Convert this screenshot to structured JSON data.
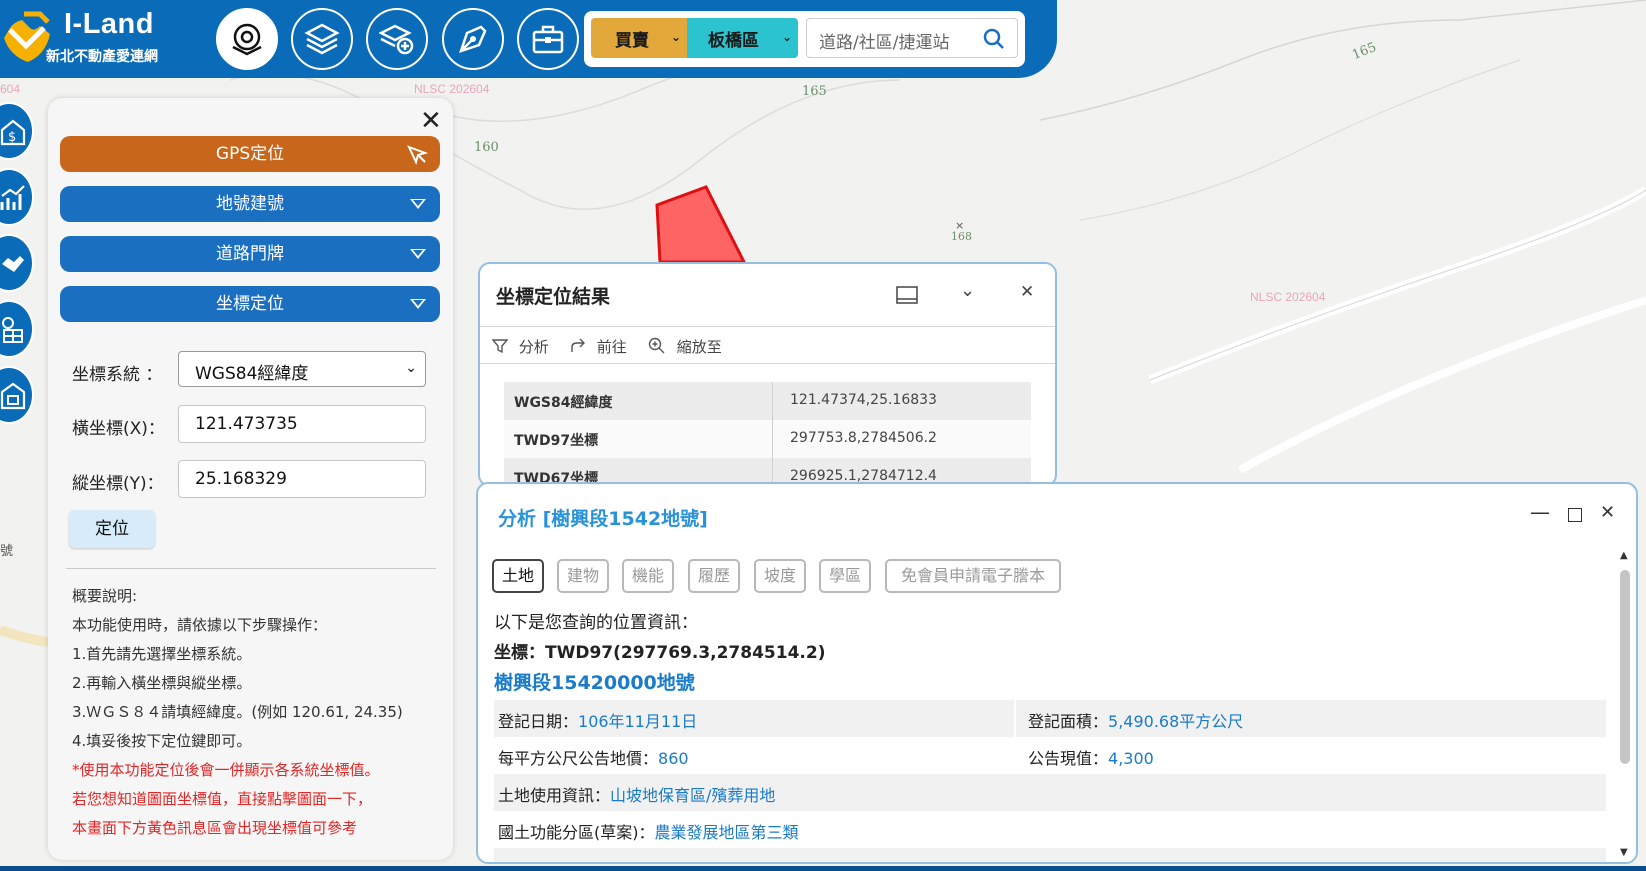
{
  "app": {
    "title": "I-Land",
    "subtitle": "新北不動產愛連網",
    "colors": {
      "brand_blue": "#0a6bb8",
      "mode_gold": "#e2a93a",
      "district_cyan": "#2bc3cf",
      "gps_orange": "#c8671b",
      "link_blue": "#1a7bc8"
    }
  },
  "toolbar": {
    "icons": [
      "target-layers-icon",
      "layers-icon",
      "add-layer-icon",
      "pen-icon",
      "toolbox-icon"
    ],
    "mode_select": "買賣",
    "district_select": "板橋區",
    "search_placeholder": "道路/社區/捷運站"
  },
  "map": {
    "contour_labels": [
      "160",
      "165",
      "165",
      "168"
    ],
    "watermarks": [
      "NLSC 202604",
      "NLSC 202604"
    ],
    "partial_labels": [
      "604",
      "號"
    ]
  },
  "locate_panel": {
    "gps_label": "GPS定位",
    "sections": [
      "地號建號",
      "道路門牌",
      "坐標定位"
    ],
    "coord_system_label": "坐標系統 ：",
    "coord_system_value": "WGS84經緯度",
    "x_label": "橫坐標(X)：",
    "x_value": "121.473735",
    "y_label": "縱坐標(Y)：",
    "y_value": "25.168329",
    "locate_button": "定位",
    "help_title": "概要說明:",
    "help_lines": [
      "本功能使用時，請依據以下步驟操作：",
      "1.首先請先選擇坐標系統。",
      "2.再輸入橫坐標與縱坐標。",
      "3.ＷＧＳ８４請填經緯度。(例如 120.61, 24.35)",
      "4.填妥後按下定位鍵即可。"
    ],
    "help_red_lines": [
      "*使用本功能定位後會一併顯示各系統坐標值。",
      "若您想知道圖面坐標值，直接點擊圖面一下，",
      "本畫面下方黃色訊息區會出現坐標值可參考"
    ]
  },
  "coord_window": {
    "title": "坐標定位結果",
    "tools": [
      "分析",
      "前往",
      "縮放至"
    ],
    "rows": [
      {
        "key": "WGS84經緯度",
        "value": "121.47374,25.16833"
      },
      {
        "key": "TWD97坐標",
        "value": "297753.8,2784506.2"
      },
      {
        "key": "TWD67坐標",
        "value": "296925.1,2784712.4"
      }
    ]
  },
  "analysis_window": {
    "title": "分析 [樹興段1542地號]",
    "tabs": [
      "土地",
      "建物",
      "機能",
      "履歷",
      "坡度",
      "學區",
      "免會員申請電子謄本"
    ],
    "intro": "以下是您查詢的位置資訊：",
    "coord_line": "坐標：TWD97(297769.3,2784514.2)",
    "parcel": "樹興段15420000地號",
    "rows": [
      {
        "l1": "登記日期：",
        "v1": "106年11月11日",
        "l2": "登記面積：",
        "v2": "5,490.68平方公尺"
      },
      {
        "l1": "每平方公尺公告地價：",
        "v1": "860",
        "l2": "公告現值：",
        "v2": "4,300"
      },
      {
        "l1": "土地使用資訊：",
        "v1": "山坡地保育區/殯葬用地"
      },
      {
        "l1": "國土功能分區(草案)：",
        "v1": "農業發展地區第三類"
      }
    ]
  }
}
